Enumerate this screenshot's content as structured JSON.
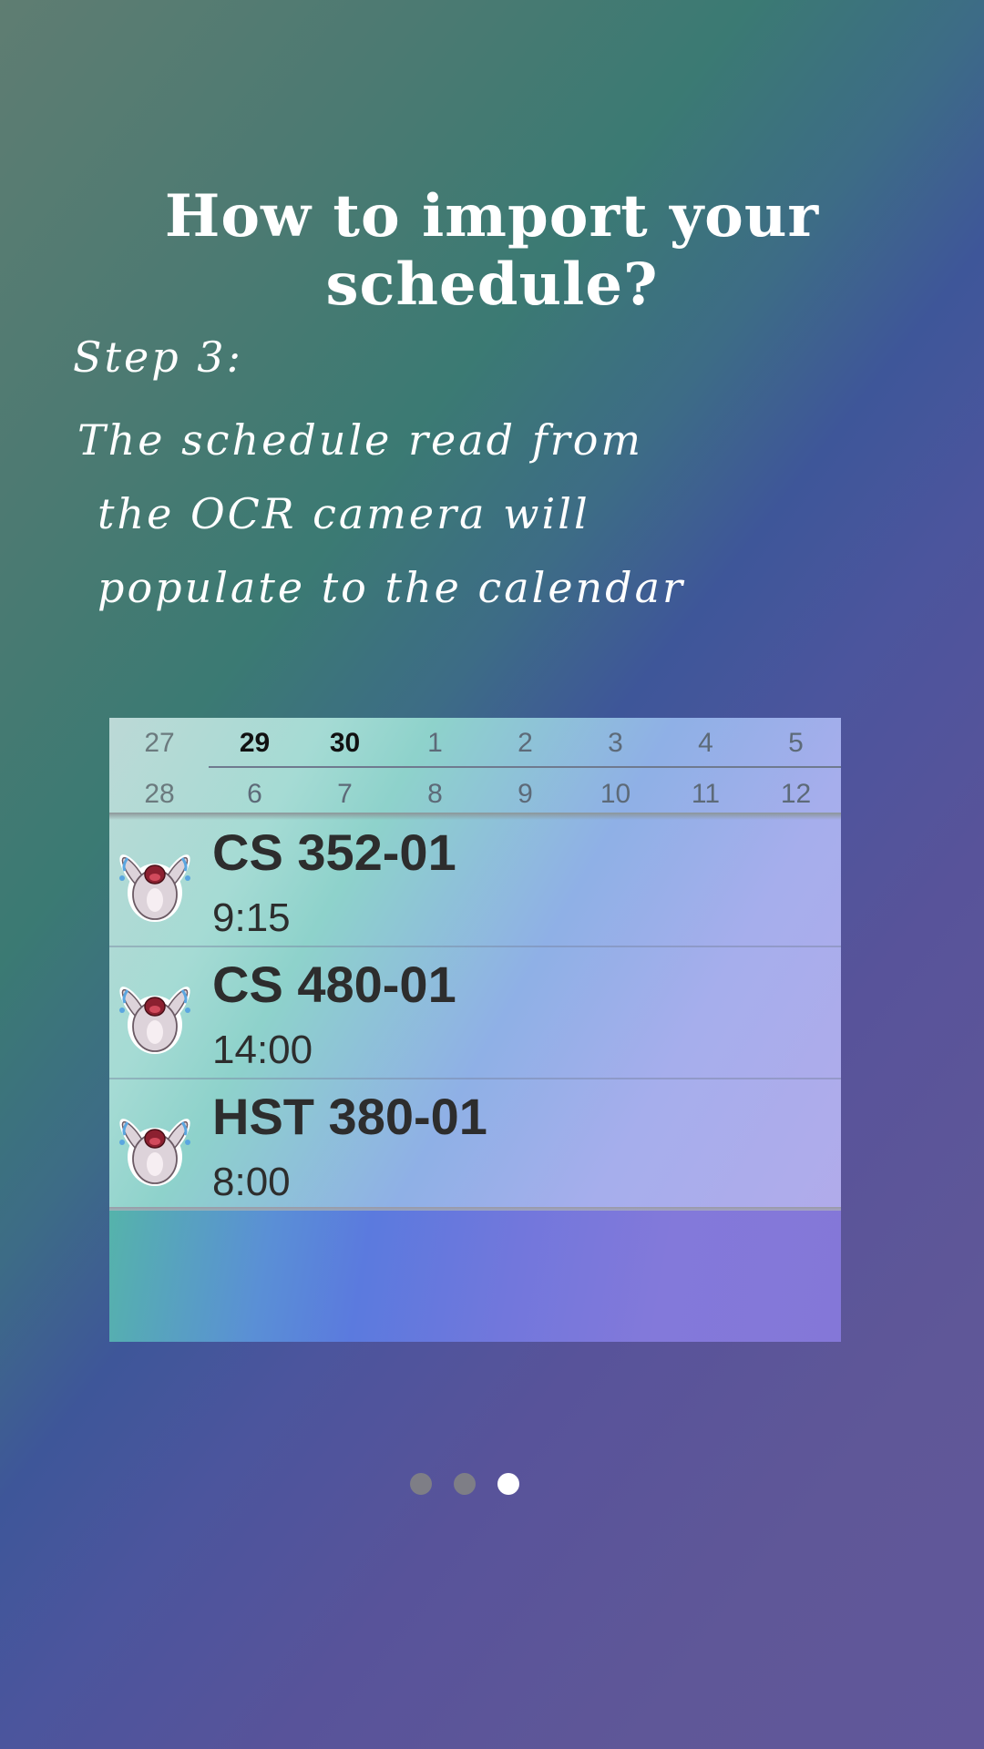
{
  "title": "How to import your schedule?",
  "step_label": "Step 3:",
  "description_lines": [
    "The schedule read from",
    "the OCR camera will",
    "populate to the calendar"
  ],
  "calendar": {
    "row1": [
      "27",
      "29",
      "30",
      "1",
      "2",
      "3",
      "4",
      "5"
    ],
    "row2": [
      "28",
      "6",
      "7",
      "8",
      "9",
      "10",
      "11",
      "12"
    ]
  },
  "events": [
    {
      "name": "CS 352-01",
      "time": "9:15"
    },
    {
      "name": "CS 480-01",
      "time": "14:00"
    },
    {
      "name": "HST 380-01",
      "time": "8:00"
    }
  ],
  "page_indicator": {
    "total": 3,
    "current": 3
  },
  "icons": {
    "event_icon": "crying-bunny-icon"
  },
  "colors": {
    "title_text": "#ffffff",
    "active_dot": "#ffffff",
    "inactive_dot": "#7e7e86"
  }
}
